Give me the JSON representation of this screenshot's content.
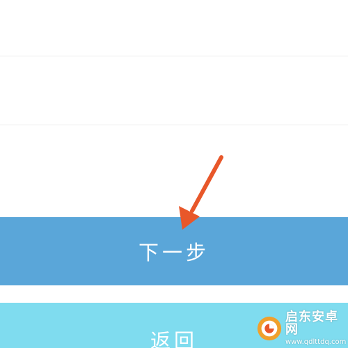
{
  "buttons": {
    "next_label": "下一步",
    "back_label": "返回"
  },
  "watermark": {
    "title": "启东安卓网",
    "url": "www.qdlttdq.com"
  },
  "colors": {
    "next_button": "#5aa6d9",
    "back_button": "#7fdcef",
    "arrow": "#e8572a"
  }
}
